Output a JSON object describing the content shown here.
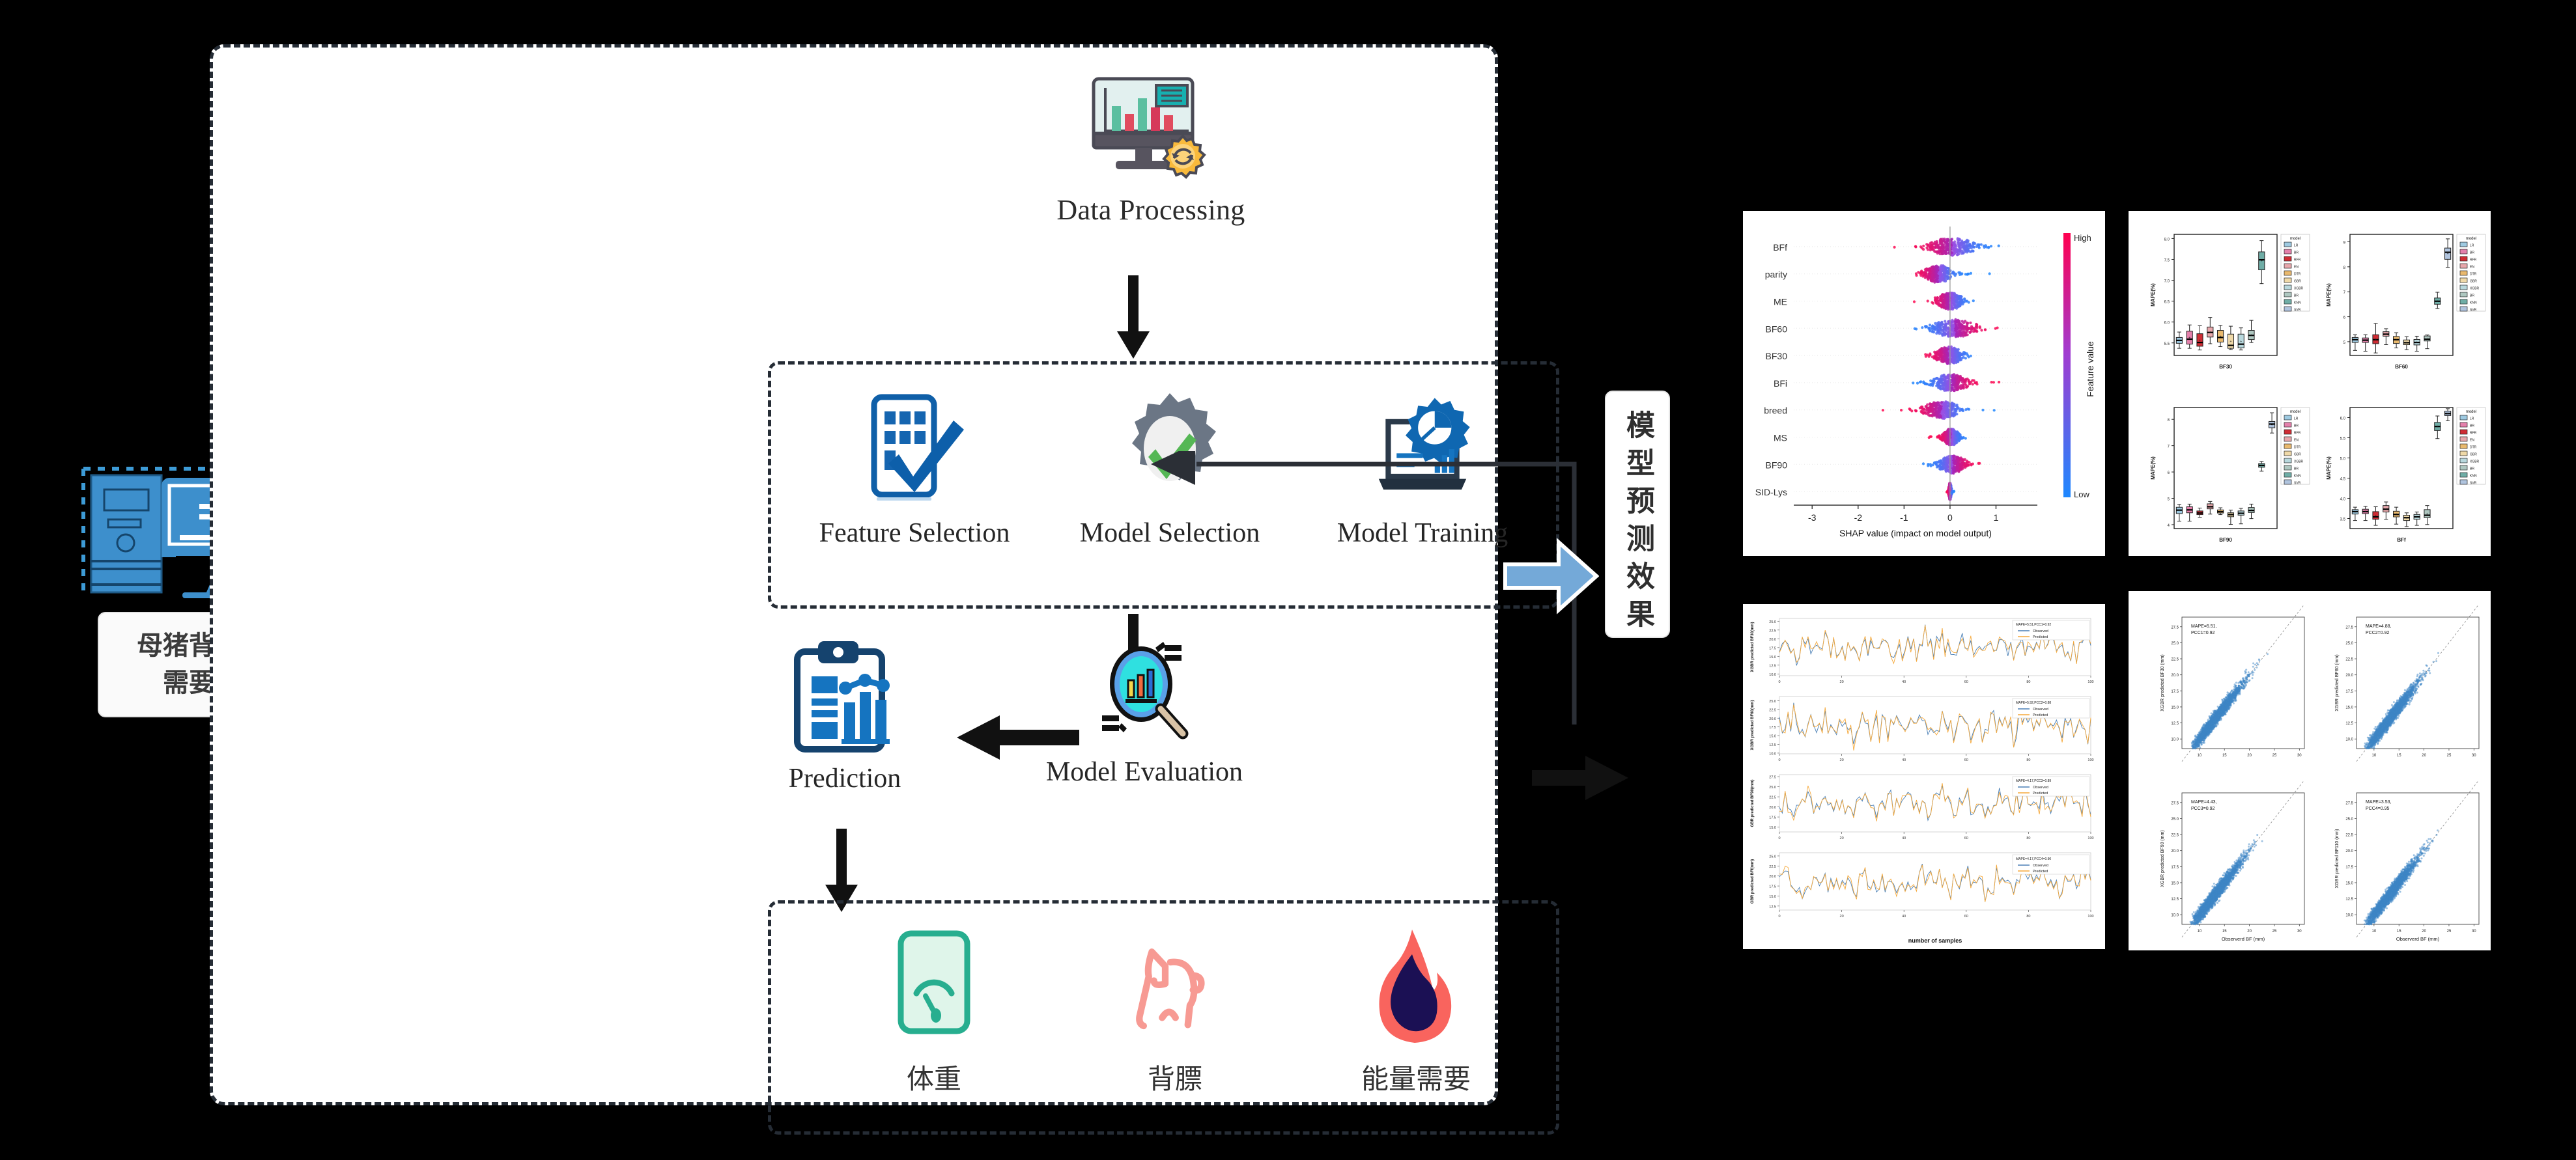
{
  "input": {
    "icon": "desktop-computer-icon",
    "caption": "母猪背膘、体重、能量\n需要智能预测系统"
  },
  "arrows": {
    "blue_1": "blue-right-arrow",
    "blue_2": "blue-right-arrow",
    "accent_color": "#74a9d8"
  },
  "pipeline": {
    "data_processing": {
      "label": "Data Processing",
      "icon": "monitor-chart-gear-icon"
    },
    "training_box": {
      "steps": [
        {
          "label": "Feature Selection",
          "icon": "checklist-check-icon"
        },
        {
          "label": "Model Selection",
          "icon": "gear-check-icon"
        },
        {
          "label": "Model Training",
          "icon": "laptop-gear-chart-icon"
        }
      ]
    },
    "evaluation": {
      "label": "Model Evaluation",
      "icon": "magnifier-barchart-icon"
    },
    "prediction": {
      "label": "Prediction",
      "icon": "clipboard-report-icon"
    },
    "outputs": {
      "items": [
        {
          "label": "体重",
          "icon": "scale-gauge-icon",
          "color": "#27ae8f"
        },
        {
          "label": "背膘",
          "icon": "pig-outline-icon",
          "color": "#f79a93"
        },
        {
          "label": "能量需要",
          "icon": "flame-icon",
          "color": "#f9645e"
        }
      ]
    }
  },
  "results": {
    "label": "模型预测效果"
  },
  "chart_data": [
    {
      "id": "shap-beeswarm",
      "type": "scatter",
      "title": "",
      "xlabel": "SHAP value (impact on model output)",
      "ylabel": "",
      "xticks": [
        "-3",
        "-2",
        "-1",
        "0",
        "1"
      ],
      "xlim": [
        -3.4,
        1.9
      ],
      "features": [
        "BFf",
        "parity",
        "ME",
        "BF60",
        "BF30",
        "BFi",
        "breed",
        "MS",
        "BF90",
        "SID-Lys"
      ],
      "colorbar": {
        "label": "Feature value",
        "high": "High",
        "low": "Low",
        "high_color": "#ff0050",
        "low_color": "#1e88ff"
      },
      "grid": false,
      "legend_position": "right"
    },
    {
      "id": "model-mape-boxplots",
      "type": "bar",
      "title": "",
      "ylabel": "MAPE(%)",
      "legend_title": "model",
      "legend_position": "right",
      "models": [
        "LR",
        "BR",
        "RFR",
        "EN",
        "DTR",
        "GBR",
        "XGBR",
        "BR",
        "KNN",
        "SVR"
      ],
      "model_colors": [
        "#9ecae1",
        "#e480ab",
        "#cf2c34",
        "#e8a8ac",
        "#e9b96e",
        "#efd9a8",
        "#b8d8dd",
        "#aec7c0",
        "#6fada6",
        "#b0c4de"
      ],
      "panels": [
        {
          "xlabel": "BF30",
          "yticks": [
            "5.5",
            "6.0",
            "6.5",
            "7.0",
            "7.5",
            "8.0"
          ],
          "ylim": [
            5.2,
            8.1
          ],
          "medians": [
            5.56,
            5.59,
            5.51,
            5.75,
            5.63,
            5.44,
            5.47,
            5.68,
            7.49,
            null
          ],
          "q1": [
            5.49,
            5.47,
            5.42,
            5.64,
            5.52,
            5.37,
            5.38,
            5.58,
            7.25,
            null
          ],
          "q3": [
            5.63,
            5.78,
            5.72,
            5.88,
            5.8,
            5.71,
            5.71,
            5.8,
            7.68,
            null
          ],
          "whisk_lo": [
            5.37,
            5.37,
            5.33,
            5.48,
            5.41,
            5.34,
            5.33,
            5.51,
            6.92,
            null
          ],
          "whisk_hi": [
            5.76,
            5.93,
            5.91,
            6.11,
            5.92,
            5.9,
            5.86,
            6.04,
            7.95,
            null
          ]
        },
        {
          "xlabel": "BF60",
          "yticks": [
            "5",
            "6",
            "7",
            "8",
            "9"
          ],
          "ylim": [
            4.45,
            9.3
          ],
          "medians": [
            5.08,
            5.06,
            5.08,
            5.3,
            5.08,
            4.96,
            4.97,
            5.1,
            6.62,
            8.58
          ],
          "q1": [
            4.97,
            4.97,
            4.92,
            5.22,
            4.93,
            4.88,
            4.87,
            5.03,
            6.5,
            8.3
          ],
          "whisk_lo": [
            4.65,
            4.62,
            4.55,
            4.88,
            4.75,
            4.68,
            4.62,
            4.72,
            6.33,
            7.98
          ],
          "q3": [
            5.17,
            5.15,
            5.28,
            5.4,
            5.21,
            5.07,
            5.09,
            5.23,
            6.75,
            8.75
          ],
          "whisk_hi": [
            5.28,
            5.28,
            5.73,
            5.52,
            5.36,
            5.2,
            5.22,
            5.27,
            6.98,
            9.12
          ]
        },
        {
          "xlabel": "BF90",
          "yticks": [
            "4",
            "5",
            "6",
            "7",
            "8"
          ],
          "ylim": [
            3.85,
            8.45
          ],
          "medians": [
            4.55,
            4.56,
            4.44,
            4.68,
            4.49,
            4.38,
            4.43,
            4.54,
            6.25,
            7.82
          ],
          "q1": [
            4.42,
            4.45,
            4.38,
            4.6,
            4.44,
            4.3,
            4.36,
            4.46,
            6.18,
            7.68
          ],
          "whisk_lo": [
            4.13,
            4.13,
            4.28,
            4.4,
            4.38,
            4.01,
            4.03,
            4.23,
            6.03,
            7.48
          ],
          "q3": [
            4.66,
            4.68,
            4.52,
            4.79,
            4.56,
            4.45,
            4.52,
            4.65,
            6.32,
            7.92
          ],
          "whisk_hi": [
            4.77,
            4.78,
            4.63,
            4.88,
            4.64,
            4.55,
            4.62,
            4.78,
            6.4,
            8.25
          ]
        },
        {
          "xlabel": "BFf",
          "yticks": [
            "3.5",
            "4.0",
            "4.5",
            "5.0",
            "5.5",
            "6.0"
          ],
          "ylim": [
            3.25,
            6.25
          ],
          "medians": [
            3.67,
            3.67,
            3.54,
            3.73,
            3.6,
            3.52,
            3.54,
            3.58,
            5.78,
            6.1
          ],
          "q1": [
            3.61,
            3.62,
            3.48,
            3.66,
            3.54,
            3.45,
            3.48,
            3.52,
            5.68,
            6.05
          ],
          "whisk_lo": [
            3.45,
            3.45,
            3.33,
            3.48,
            3.36,
            3.3,
            3.33,
            3.35,
            5.48,
            5.92
          ],
          "q3": [
            3.72,
            3.73,
            3.67,
            3.82,
            3.68,
            3.58,
            3.6,
            3.72,
            5.88,
            6.16
          ],
          "whisk_hi": [
            3.78,
            3.8,
            3.79,
            3.91,
            3.78,
            3.64,
            3.66,
            3.82,
            6.04,
            6.22
          ]
        }
      ]
    },
    {
      "id": "observed-vs-predicted-series",
      "type": "line",
      "xlabel": "number of samples",
      "xticks": [
        "0",
        "20",
        "40",
        "60",
        "80",
        "100"
      ],
      "xlim": [
        0,
        100
      ],
      "legend_series": [
        "Observed",
        "Predicted"
      ],
      "series_colors": [
        "#4a7fb5",
        "#f5a93c"
      ],
      "panels": [
        {
          "ylabel": "XGBR predicted BF30(mm)",
          "yticks": [
            "10.0",
            "12.5",
            "15.0",
            "17.5",
            "20.0",
            "22.5",
            "25.0"
          ],
          "ylim": [
            9.5,
            25.8
          ],
          "annotation": "MAPE=5.51,PCC1=0.92"
        },
        {
          "ylabel": "XGBR predicted BF60(mm)",
          "yticks": [
            "10.0",
            "12.5",
            "15.0",
            "17.5",
            "20.0",
            "22.5",
            "25.0"
          ],
          "ylim": [
            9.8,
            26.2
          ],
          "annotation": "MAPE=5.92,PCC2=0.88"
        },
        {
          "ylabel": "GBR predicted BF90(mm)",
          "yticks": [
            "15.0",
            "17.5",
            "20.0",
            "22.5",
            "25.0",
            "27.5"
          ],
          "ylim": [
            13.8,
            28.0
          ],
          "annotation": "MAPE=4.17,PCC3=0.89"
        },
        {
          "ylabel": "GBR predicted BFf(mm)",
          "yticks": [
            "12.5",
            "15.0",
            "17.5",
            "20.0",
            "22.5",
            "25.0"
          ],
          "ylim": [
            11.5,
            25.8
          ],
          "annotation": "MAPE=4.17,PCC4=0.90"
        }
      ]
    },
    {
      "id": "observed-vs-predicted-scatter",
      "type": "scatter",
      "xlabel": "Observerd BF (mm)",
      "xticks": [
        "10",
        "15",
        "20",
        "25",
        "30"
      ],
      "xlim": [
        6.5,
        31
      ],
      "point_color": "#3d85c6",
      "panels": [
        {
          "ylabel": "XGBR predicted BF30 (mm)",
          "yticks": [
            "10.0",
            "12.5",
            "15.0",
            "17.5",
            "20.0",
            "22.5",
            "25.0",
            "27.5"
          ],
          "ylim": [
            8.5,
            29.0
          ],
          "annotation_1": "MAPE=5.51,",
          "annotation_2": "PCC1=0.92"
        },
        {
          "ylabel": "XGBR predicted BF60 (mm)",
          "yticks": [
            "10.0",
            "12.5",
            "15.0",
            "17.5",
            "20.0",
            "22.5",
            "25.0",
            "27.5"
          ],
          "ylim": [
            8.5,
            29.0
          ],
          "annotation_1": "MAPE=4.88,",
          "annotation_2": "PCC2=0.92"
        },
        {
          "ylabel": "XGBR predicted BF90 (mm)",
          "yticks": [
            "10.0",
            "12.5",
            "15.0",
            "17.5",
            "20.0",
            "22.5",
            "25.0",
            "27.5"
          ],
          "ylim": [
            8.5,
            29.0
          ],
          "annotation_1": "MAPE=4.43,",
          "annotation_2": "PCC3=0.92"
        },
        {
          "ylabel": "XGBR predicted BF110 (mm)",
          "yticks": [
            "10.0",
            "12.5",
            "15.0",
            "17.5",
            "20.0",
            "22.5",
            "25.0",
            "27.5"
          ],
          "ylim": [
            8.5,
            29.0
          ],
          "annotation_1": "MAPE=3.53,",
          "annotation_2": "PCC4=0.95"
        }
      ]
    }
  ]
}
